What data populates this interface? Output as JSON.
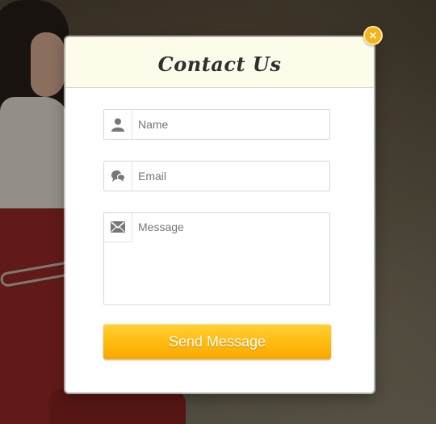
{
  "modal": {
    "title": "Contact Us",
    "close_symbol": "×"
  },
  "form": {
    "name": {
      "placeholder": "Name",
      "icon": "user-icon"
    },
    "email": {
      "placeholder": "Email",
      "icon": "chat-bubble-icon"
    },
    "message": {
      "placeholder": "Message",
      "icon": "envelope-icon"
    },
    "submit_label": "Send Message"
  },
  "colors": {
    "accent": "#ffbe13",
    "header_bg": "#fdfbe9",
    "icon": "#777777"
  }
}
